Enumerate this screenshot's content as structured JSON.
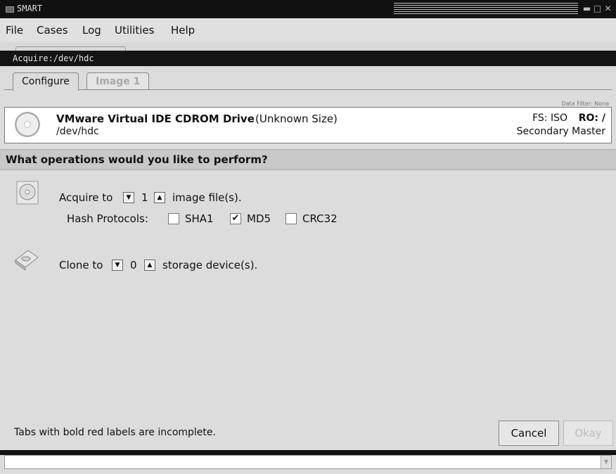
{
  "window": {
    "title": "SMART"
  },
  "menu": [
    "File",
    "Cases",
    "Log",
    "Utilities",
    "Help"
  ],
  "document": {
    "title": "Acquire:/dev/hdc"
  },
  "tabs": [
    {
      "label": "Configure",
      "active": true
    },
    {
      "label": "Image 1",
      "active": false
    }
  ],
  "device": {
    "data_filter": "Data Filter: None",
    "name": "VMware Virtual IDE CDROM Drive",
    "size": "(Unknown Size)",
    "path": "/dev/hdc",
    "fs": "FS: ISO",
    "ro": "RO: /",
    "position": "Secondary Master"
  },
  "operations": {
    "question": "What operations would you like to perform?",
    "acquire": {
      "prefix": "Acquire to",
      "count": "1",
      "suffix": "image file(s).",
      "hash_label": "Hash Protocols:",
      "hashes": [
        {
          "label": "SHA1",
          "checked": false
        },
        {
          "label": "MD5",
          "checked": true
        },
        {
          "label": "CRC32",
          "checked": false
        }
      ]
    },
    "clone": {
      "prefix": "Clone to",
      "count": "0",
      "suffix": "storage device(s)."
    }
  },
  "status": "Tabs with bold red labels are incomplete.",
  "buttons": {
    "cancel": "Cancel",
    "okay": "Okay"
  },
  "icons": {
    "spin_down": "▼",
    "spin_up": "▲",
    "check": "✔"
  }
}
